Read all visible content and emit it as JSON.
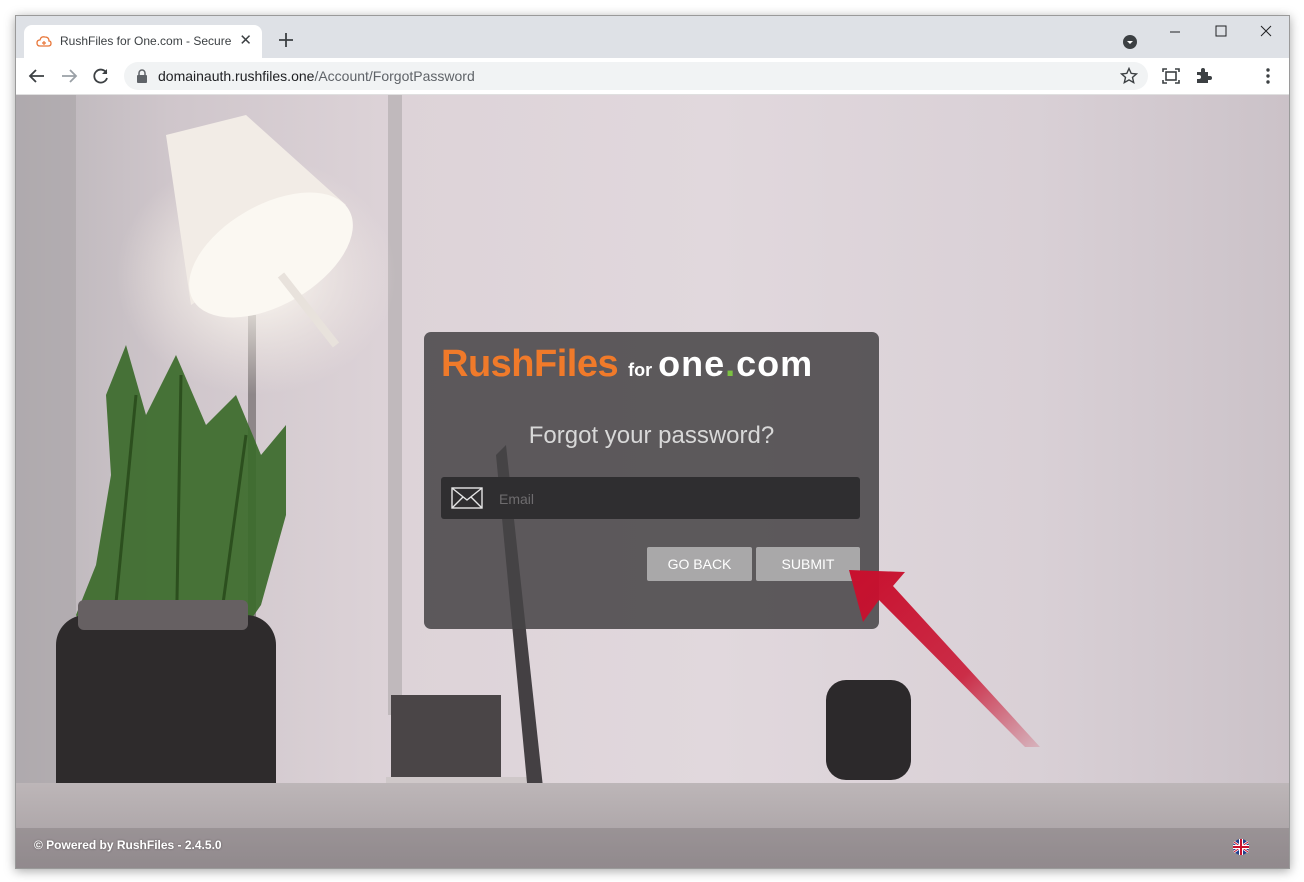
{
  "browser": {
    "tab_title": "RushFiles for One.com - Securely share and store",
    "tab_close": "✕",
    "new_tab": "+",
    "url_domain": "domainauth.rushfiles.one",
    "url_path": "/Account/ForgotPassword"
  },
  "card": {
    "logo_brand": "RushFiles",
    "logo_for": "for",
    "logo_partner_a": "one",
    "logo_partner_dot": ".",
    "logo_partner_b": "com",
    "heading": "Forgot your password?",
    "email_placeholder": "Email",
    "go_back_label": "GO BACK",
    "submit_label": "SUBMIT"
  },
  "footer": {
    "powered_by": "© Powered by RushFiles - 2.4.5.0"
  },
  "icons": [
    "rushfiles-favicon-icon",
    "close-icon",
    "plus-icon",
    "tab-search-icon",
    "minimize-icon",
    "maximize-icon",
    "window-close-icon",
    "back-arrow-icon",
    "forward-arrow-icon",
    "reload-icon",
    "lock-icon",
    "star-icon",
    "media-icon",
    "extensions-icon",
    "menu-icon",
    "envelope-icon",
    "uk-flag-icon",
    "red-arrow-icon"
  ],
  "colors": {
    "brand_orange": "#f07a2a",
    "partner_green": "#7cc242",
    "card_bg": "#464446",
    "button_bg": "#a9a8a9",
    "arrow_red": "#c8102e"
  }
}
